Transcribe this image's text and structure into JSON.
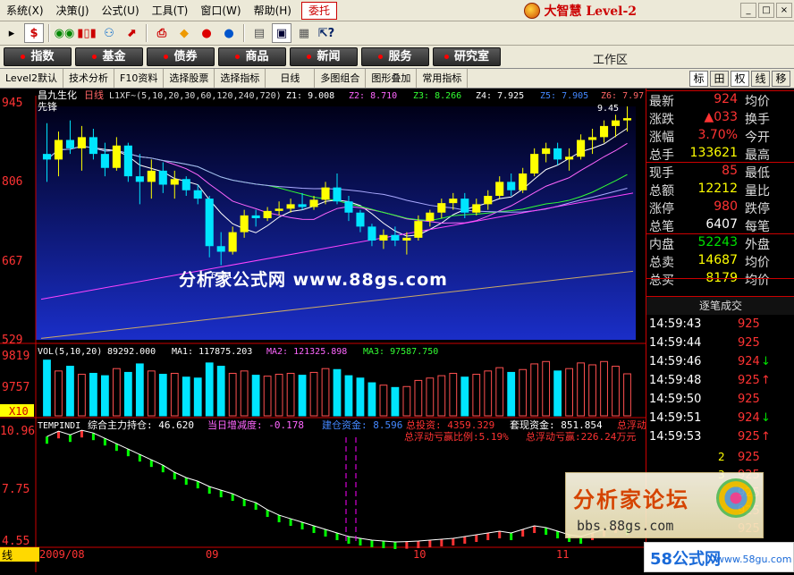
{
  "menubar": {
    "items": [
      "系统(X)",
      "决策(J)",
      "公式(U)",
      "工具(T)",
      "窗口(W)",
      "帮助(H)"
    ],
    "highlight": "委托",
    "brand": "大智慧 Level-2",
    "win_buttons": [
      "_",
      "□",
      "×"
    ]
  },
  "toolbar": {
    "icons": [
      "dollar-icon",
      "glasses-icon",
      "bars-icon",
      "binoculars-icon",
      "chart-icon",
      "printer-icon",
      "diamond-icon",
      "red-circle-icon",
      "blue-circle-icon",
      "notepad-icon",
      "window-icon",
      "calendar-icon",
      "help-icon"
    ]
  },
  "funcbar": {
    "buttons": [
      "指数",
      "基金",
      "债券",
      "商品",
      "新闻",
      "服务",
      "研究室"
    ],
    "workzone": "工作区"
  },
  "tabbar": {
    "tabs": [
      "Level2默认",
      "技术分析",
      "F10资料",
      "选择股票",
      "选择指标",
      "日线",
      "多图组合",
      "图形叠加",
      "常用指标"
    ],
    "right_tabs": [
      "标",
      "田",
      "权",
      "线",
      "移"
    ]
  },
  "chart": {
    "stock_name": "昌九生化",
    "period": "日线",
    "ma_label": "L1XF~(5,10,20,30,60,120,240,720)",
    "z1": "Z1: 9.008",
    "z2": "Z2: 8.710",
    "z3": "Z3: 8.266",
    "z4": "Z4: 7.925",
    "z5": "Z5: 7.905",
    "z6": "Z6: 7.97",
    "xianfeng": "先锋",
    "price_ticks": [
      "945",
      "806",
      "667",
      "529"
    ],
    "high_marker": "9.45",
    "low_marker": "6.61",
    "watermark": "分析家公式网 www.88gs.com",
    "vol_label": "VOL(5,10,20)",
    "vol_value": "89292.000",
    "ma1": "MA1: 117875.203",
    "ma2": "MA2: 121325.898",
    "ma3": "MA3: 97587.750",
    "vol_ticks": [
      "9819",
      "9757",
      "X10"
    ],
    "ind_label": "TEMPINDI",
    "ind_hold": "综合主力持仓: 46.620",
    "ind_daily": "当日增减度: -0.178",
    "ind_extra": "建仓资金: 8.596",
    "ind_invest": "总投资: 4359.329",
    "ind_cash": "套现资金: 851.854",
    "ind_float": "总浮动",
    "ind_ratio": "总浮动亏赢比例:5.19%",
    "ind_amount": "总浮动亏赢:226.24万元",
    "ind_ticks": [
      "10.96",
      "7.75",
      "4.55"
    ],
    "date_labels": [
      "2009/08",
      "09",
      "10",
      "11"
    ],
    "status_char": "线"
  },
  "chart_data": {
    "type": "candlestick",
    "title": "昌九生化 日线",
    "ylim": [
      5.29,
      9.45
    ],
    "candles": [
      [
        8.6,
        9.15,
        8.1,
        8.5
      ],
      [
        8.5,
        9.0,
        8.2,
        8.85
      ],
      [
        8.85,
        9.2,
        8.6,
        8.7
      ],
      [
        8.7,
        9.1,
        8.3,
        8.9
      ],
      [
        8.9,
        9.05,
        8.5,
        8.6
      ],
      [
        8.6,
        8.8,
        8.2,
        8.35
      ],
      [
        8.35,
        8.9,
        8.3,
        8.75
      ],
      [
        8.75,
        8.8,
        8.1,
        8.2
      ],
      [
        8.2,
        8.6,
        7.7,
        8.1
      ],
      [
        8.1,
        8.5,
        7.8,
        8.3
      ],
      [
        8.3,
        8.45,
        7.9,
        8.05
      ],
      [
        8.05,
        8.3,
        7.8,
        8.15
      ],
      [
        8.15,
        8.2,
        7.85,
        7.95
      ],
      [
        7.95,
        8.05,
        7.7,
        7.8
      ],
      [
        7.8,
        7.85,
        6.75,
        6.95
      ],
      [
        6.95,
        7.2,
        6.61,
        6.85
      ],
      [
        6.85,
        7.3,
        6.8,
        7.2
      ],
      [
        7.2,
        7.6,
        7.1,
        7.5
      ],
      [
        7.5,
        7.6,
        7.3,
        7.45
      ],
      [
        7.45,
        7.65,
        7.4,
        7.58
      ],
      [
        7.58,
        7.75,
        7.5,
        7.62
      ],
      [
        7.62,
        7.8,
        7.55,
        7.7
      ],
      [
        7.7,
        7.9,
        7.6,
        7.65
      ],
      [
        7.65,
        7.85,
        7.6,
        7.78
      ],
      [
        7.78,
        8.1,
        7.7,
        8.0
      ],
      [
        8.0,
        8.25,
        7.7,
        7.75
      ],
      [
        7.75,
        7.85,
        7.4,
        7.55
      ],
      [
        7.55,
        7.6,
        7.2,
        7.3
      ],
      [
        7.3,
        7.35,
        6.95,
        7.05
      ],
      [
        7.05,
        7.25,
        6.9,
        7.15
      ],
      [
        7.15,
        7.3,
        6.95,
        7.05
      ],
      [
        7.05,
        7.2,
        6.8,
        7.1
      ],
      [
        7.1,
        7.5,
        7.05,
        7.4
      ],
      [
        7.4,
        7.6,
        7.3,
        7.55
      ],
      [
        7.55,
        7.8,
        7.45,
        7.72
      ],
      [
        7.72,
        7.9,
        7.6,
        7.8
      ],
      [
        7.8,
        7.9,
        7.45,
        7.55
      ],
      [
        7.55,
        7.8,
        7.5,
        7.7
      ],
      [
        7.7,
        7.95,
        7.6,
        7.85
      ],
      [
        7.85,
        8.2,
        7.8,
        8.1
      ],
      [
        8.1,
        8.25,
        7.85,
        7.95
      ],
      [
        7.95,
        8.35,
        7.9,
        8.25
      ],
      [
        8.25,
        8.7,
        8.2,
        8.6
      ],
      [
        8.6,
        8.8,
        8.45,
        8.7
      ],
      [
        8.7,
        8.8,
        8.4,
        8.5
      ],
      [
        8.5,
        8.7,
        8.3,
        8.55
      ],
      [
        8.55,
        8.95,
        8.5,
        8.85
      ],
      [
        8.85,
        9.05,
        8.6,
        8.9
      ],
      [
        8.9,
        9.2,
        8.8,
        9.1
      ],
      [
        9.1,
        9.3,
        8.9,
        9.2
      ],
      [
        9.2,
        9.45,
        9.0,
        9.24
      ]
    ],
    "volume": [
      1.18,
      0.95,
      1.05,
      0.88,
      0.9,
      0.85,
      1.0,
      0.92,
      1.1,
      0.95,
      0.88,
      0.9,
      0.82,
      0.8,
      1.12,
      1.05,
      0.9,
      0.95,
      0.86,
      0.84,
      0.88,
      0.9,
      0.86,
      0.92,
      1.0,
      0.98,
      0.85,
      0.8,
      0.7,
      0.65,
      0.6,
      0.62,
      0.75,
      0.8,
      0.85,
      0.9,
      0.82,
      0.88,
      0.95,
      1.02,
      0.92,
      0.98,
      1.1,
      1.15,
      0.95,
      1.0,
      1.12,
      1.08,
      1.15,
      1.05,
      0.89
    ],
    "indicator": [
      10.6,
      10.9,
      10.7,
      10.95,
      10.8,
      10.5,
      10.2,
      9.9,
      9.6,
      9.3,
      9.0,
      8.6,
      8.3,
      8.1,
      7.8,
      7.6,
      7.4,
      7.1,
      6.9,
      6.5,
      6.2,
      6.0,
      5.8,
      5.6,
      5.4,
      5.2,
      5.0,
      4.9,
      4.8,
      4.75,
      4.7,
      4.72,
      4.75,
      4.8,
      4.85,
      4.9,
      5.0,
      5.1,
      5.2,
      5.3,
      5.2,
      5.4,
      5.6,
      5.5,
      5.3,
      5.1,
      5.0,
      5.2,
      5.4,
      5.6,
      5.5
    ]
  },
  "quote": {
    "rows": [
      {
        "l": "最新",
        "v": "924",
        "r": "均价",
        "c": "up"
      },
      {
        "l": "涨跌",
        "v": "▲033",
        "r": "换手",
        "c": "up"
      },
      {
        "l": "涨幅",
        "v": "3.70%",
        "r": "今开",
        "c": "up"
      },
      {
        "l": "总手",
        "v": "133621",
        "r": "最高",
        "c": "yl"
      },
      {
        "l": "现手",
        "v": "85",
        "r": "最低",
        "c": "up"
      },
      {
        "l": "总额",
        "v": "12212",
        "r": "量比",
        "c": "yl"
      },
      {
        "l": "涨停",
        "v": "980",
        "r": "跌停",
        "c": "up"
      },
      {
        "l": "总笔",
        "v": "6407",
        "r": "每笔",
        "c": "wh"
      },
      {
        "l": "内盘",
        "v": "52243",
        "r": "外盘",
        "c": "dn"
      },
      {
        "l": "总卖",
        "v": "14687",
        "r": "均价",
        "c": "yl"
      },
      {
        "l": "总买",
        "v": "8179",
        "r": "均价",
        "c": "yl"
      }
    ],
    "ticks_title": "逐笔成交",
    "ticks": [
      {
        "t": "14:59:43",
        "p": "925",
        "a": ""
      },
      {
        "t": "14:59:44",
        "p": "925",
        "a": ""
      },
      {
        "t": "14:59:46",
        "p": "924",
        "a": "↓"
      },
      {
        "t": "14:59:48",
        "p": "925",
        "a": "↑"
      },
      {
        "t": "14:59:50",
        "p": "925",
        "a": ""
      },
      {
        "t": "14:59:51",
        "p": "924",
        "a": "↓"
      },
      {
        "t": "14:59:53",
        "p": "925",
        "a": "↑"
      }
    ],
    "small_nums": [
      "2",
      "3"
    ],
    "more_prices": [
      "925",
      "925",
      "925",
      "925",
      "925"
    ]
  },
  "overlay": {
    "forum_title": "分析家论坛",
    "forum_url": "bbs.88gs.com",
    "site": "58公式网",
    "site_url": "www.58gu.com"
  }
}
